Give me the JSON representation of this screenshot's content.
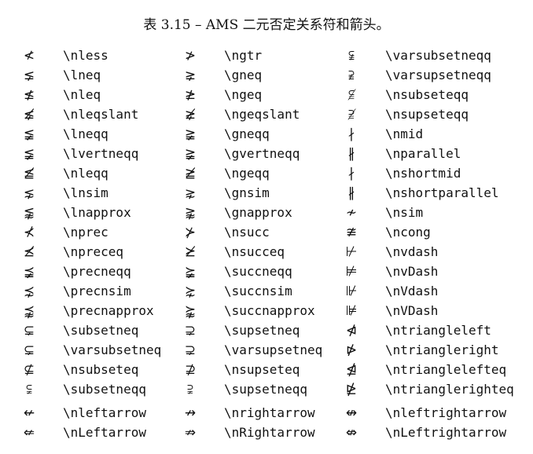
{
  "caption": "表 3.15 – AMS 二元否定关系符和箭头。",
  "columns": [
    [
      {
        "symbol": "≮",
        "command": "\\nless"
      },
      {
        "symbol": "⪇",
        "command": "\\lneq"
      },
      {
        "symbol": "≰",
        "command": "\\nleq"
      },
      {
        "symbol": "⪇̸",
        "command": "\\nleqslant"
      },
      {
        "symbol": "≨",
        "command": "\\lneqq"
      },
      {
        "symbol": "≨︀",
        "command": "\\lvertneqq"
      },
      {
        "symbol": "≦̸",
        "command": "\\nleqq"
      },
      {
        "symbol": "⋦",
        "command": "\\lnsim"
      },
      {
        "symbol": "⪉",
        "command": "\\lnapprox"
      },
      {
        "symbol": "⊀",
        "command": "\\nprec"
      },
      {
        "symbol": "⪯̸",
        "command": "\\npreceq"
      },
      {
        "symbol": "⪵",
        "command": "\\precneqq"
      },
      {
        "symbol": "⋨",
        "command": "\\precnsim"
      },
      {
        "symbol": "⪹",
        "command": "\\precnapprox"
      },
      {
        "symbol": "⊊",
        "command": "\\subsetneq"
      },
      {
        "symbol": "⊊︀",
        "command": "\\varsubsetneq"
      },
      {
        "symbol": "⊈",
        "command": "\\nsubseteq"
      },
      {
        "symbol": "⫋",
        "command": "\\subsetneqq"
      },
      {
        "symbol": "↚",
        "command": "\\nleftarrow"
      },
      {
        "symbol": "⇍",
        "command": "\\nLeftarrow"
      }
    ],
    [
      {
        "symbol": "≯",
        "command": "\\ngtr"
      },
      {
        "symbol": "⪈",
        "command": "\\gneq"
      },
      {
        "symbol": "≱",
        "command": "\\ngeq"
      },
      {
        "symbol": "⪈̸",
        "command": "\\ngeqslant"
      },
      {
        "symbol": "≩",
        "command": "\\gneqq"
      },
      {
        "symbol": "≩︀",
        "command": "\\gvertneqq"
      },
      {
        "symbol": "≧̸",
        "command": "\\ngeqq"
      },
      {
        "symbol": "⋧",
        "command": "\\gnsim"
      },
      {
        "symbol": "⪊",
        "command": "\\gnapprox"
      },
      {
        "symbol": "⊁",
        "command": "\\nsucc"
      },
      {
        "symbol": "⪰̸",
        "command": "\\nsucceq"
      },
      {
        "symbol": "⪶",
        "command": "\\succneqq"
      },
      {
        "symbol": "⋩",
        "command": "\\succnsim"
      },
      {
        "symbol": "⪺",
        "command": "\\succnapprox"
      },
      {
        "symbol": "⊋",
        "command": "\\supsetneq"
      },
      {
        "symbol": "⊋︀",
        "command": "\\varsupsetneq"
      },
      {
        "symbol": "⊉",
        "command": "\\nsupseteq"
      },
      {
        "symbol": "⫌",
        "command": "\\supsetneqq"
      },
      {
        "symbol": "↛",
        "command": "\\nrightarrow"
      },
      {
        "symbol": "⇏",
        "command": "\\nRightarrow"
      }
    ],
    [
      {
        "symbol": "⫋︀",
        "command": "\\varsubsetneqq"
      },
      {
        "symbol": "⫌︀",
        "command": "\\varsupsetneqq"
      },
      {
        "symbol": "⫅̸",
        "command": "\\nsubseteqq"
      },
      {
        "symbol": "⫆̸",
        "command": "\\nsupseteqq"
      },
      {
        "symbol": "∤",
        "command": "\\nmid"
      },
      {
        "symbol": "∦",
        "command": "\\nparallel"
      },
      {
        "symbol": "∤",
        "command": "\\nshortmid"
      },
      {
        "symbol": "∦",
        "command": "\\nshortparallel"
      },
      {
        "symbol": "≁",
        "command": "\\nsim"
      },
      {
        "symbol": "≇",
        "command": "\\ncong"
      },
      {
        "symbol": "⊬",
        "command": "\\nvdash"
      },
      {
        "symbol": "⊭",
        "command": "\\nvDash"
      },
      {
        "symbol": "⊮",
        "command": "\\nVdash"
      },
      {
        "symbol": "⊯",
        "command": "\\nVDash"
      },
      {
        "symbol": "⋪",
        "command": "\\ntriangleleft"
      },
      {
        "symbol": "⋫",
        "command": "\\ntriangleright"
      },
      {
        "symbol": "⋬",
        "command": "\\ntrianglelefteq"
      },
      {
        "symbol": "⋭",
        "command": "\\ntrianglerighteq"
      },
      {
        "symbol": "↮",
        "command": "\\nleftrightarrow"
      },
      {
        "symbol": "⇎",
        "command": "\\nLeftrightarrow"
      }
    ]
  ]
}
